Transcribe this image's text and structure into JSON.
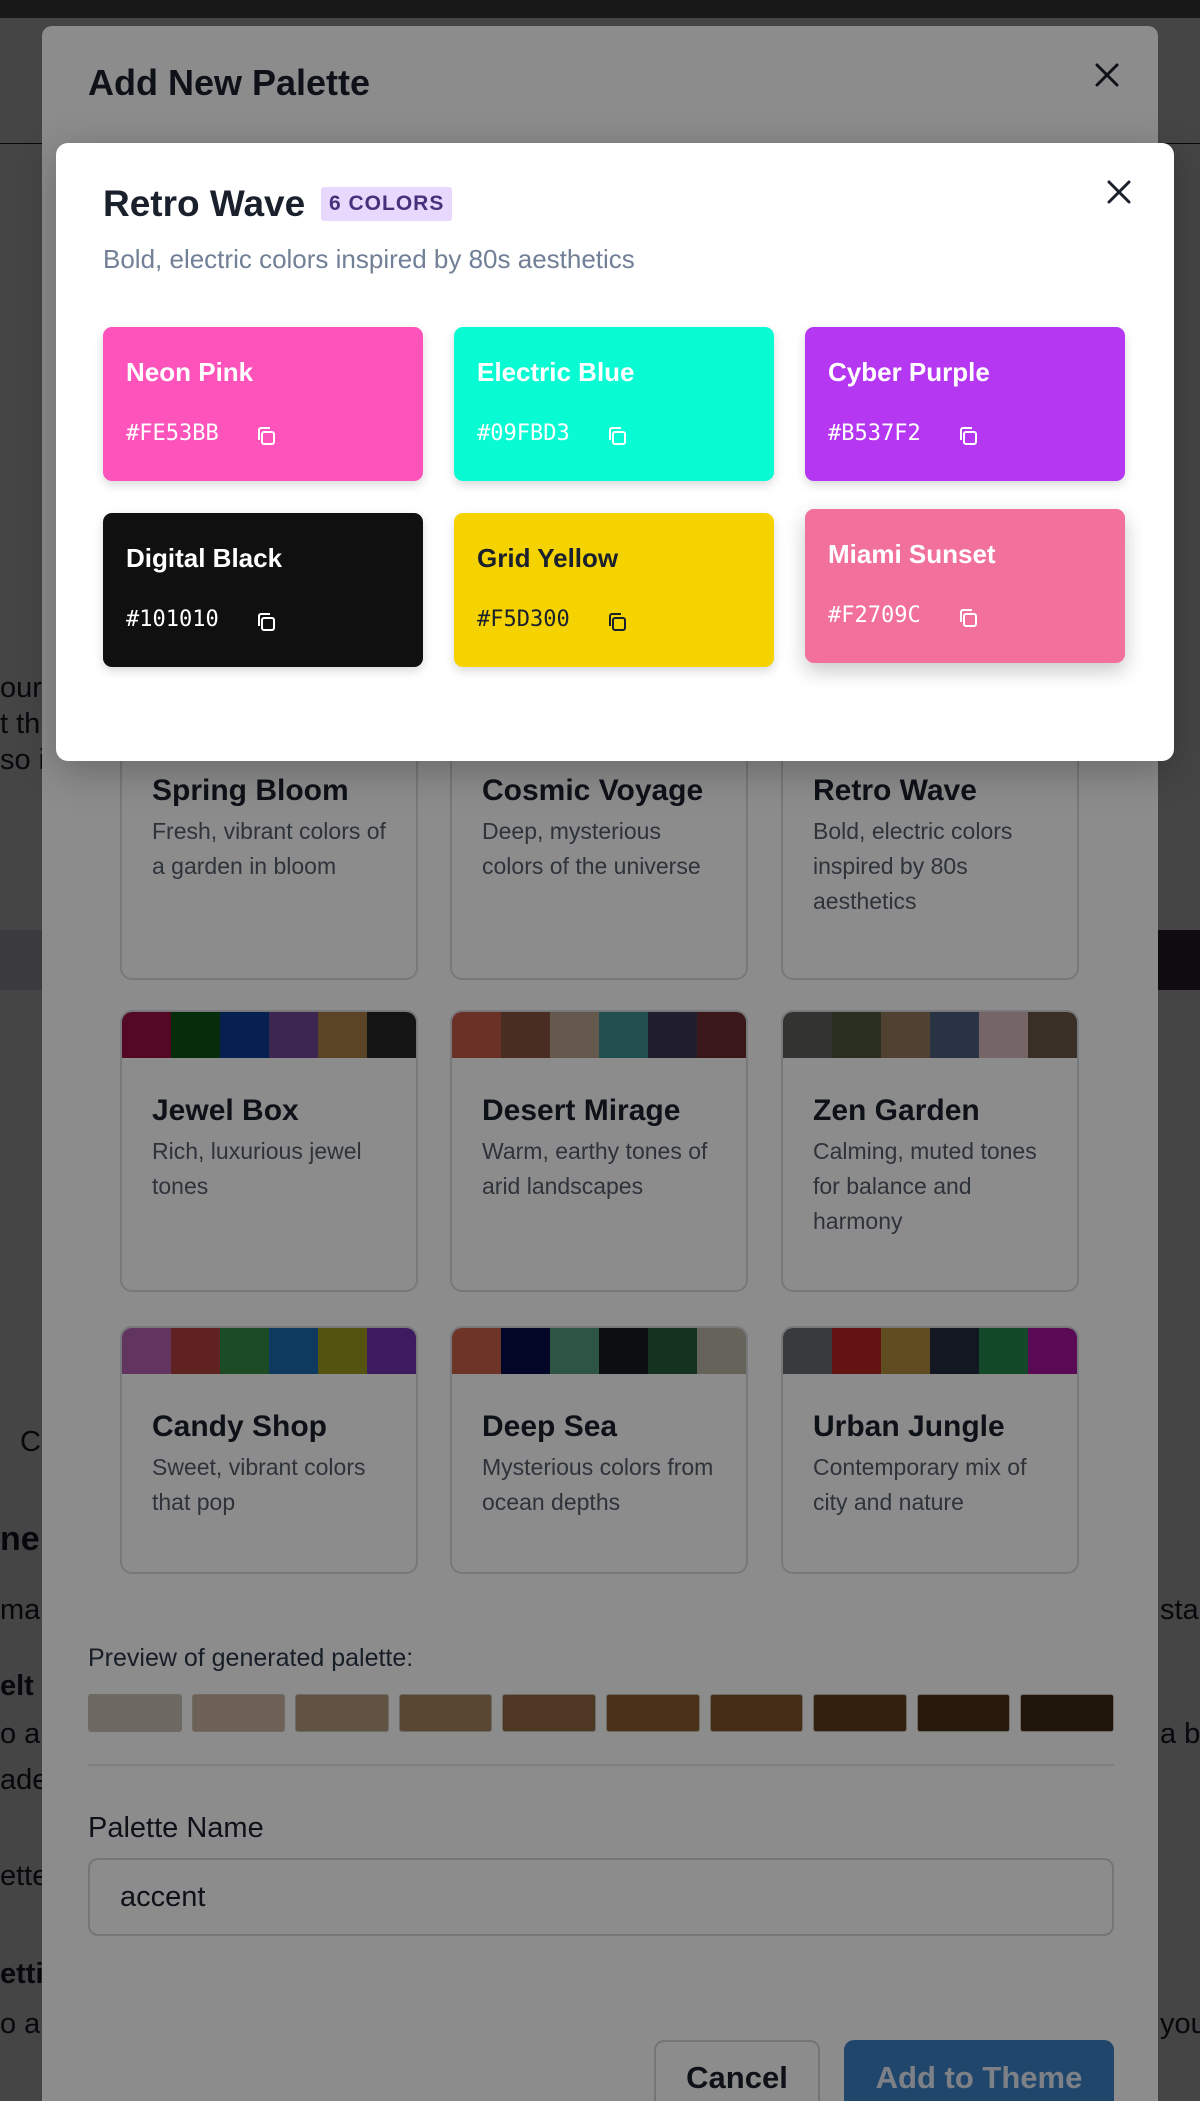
{
  "background": {
    "fragments": [
      "our",
      "t th",
      "so i",
      "C",
      "ne",
      "ma",
      "elt",
      "o ar",
      "ade",
      "ette",
      "etti",
      "o a",
      "sta",
      "a ba",
      "you"
    ]
  },
  "dialog": {
    "title": "Add New Palette",
    "presets": [
      {
        "name": "Spring Bloom",
        "description": "Fresh, vibrant colors of a garden in bloom",
        "colors": []
      },
      {
        "name": "Cosmic Voyage",
        "description": "Deep, mysterious colors of the universe",
        "colors": []
      },
      {
        "name": "Retro Wave",
        "description": "Bold, electric colors inspired by 80s aesthetics",
        "colors": []
      },
      {
        "name": "Jewel Box",
        "description": "Rich, luxurious jewel tones",
        "colors": [
          "#9b1042",
          "#0b5315",
          "#0c3b93",
          "#6f4796",
          "#a67d45",
          "#262626"
        ]
      },
      {
        "name": "Desert Mirage",
        "description": "Warm, earthy tones of arid landscapes",
        "colors": [
          "#c45a47",
          "#85533f",
          "#b9a38c",
          "#3f9190",
          "#3b3852",
          "#6b2a2c"
        ]
      },
      {
        "name": "Zen Garden",
        "description": "Calming, muted tones for balance and harmony",
        "colors": [
          "#5e5e5c",
          "#4f563f",
          "#93775a",
          "#4c5d7a",
          "#d7b8bb",
          "#6a5648"
        ]
      },
      {
        "name": "Candy Shop",
        "description": "Sweet, vibrant colors that pop",
        "colors": [
          "#b25fb0",
          "#b0403c",
          "#348a44",
          "#1c6aad",
          "#9a9a1e",
          "#7230b0"
        ]
      },
      {
        "name": "Deep Sea",
        "description": "Mysterious colors from ocean depths",
        "colors": [
          "#c85f48",
          "#090b49",
          "#559a7a",
          "#181b22",
          "#255c3a",
          "#bab7a5"
        ]
      },
      {
        "name": "Urban Jungle",
        "description": "Contemporary mix of city and nature",
        "colors": [
          "#666a6e",
          "#b42422",
          "#b08a3c",
          "#232a3c",
          "#23864a",
          "#a4129a"
        ]
      }
    ],
    "preview_label": "Preview of generated palette:",
    "preview_colors": [
      "#c7bfb3",
      "#c7b099",
      "#b3957c",
      "#a3805e",
      "#8f6642",
      "#8a5a2f",
      "#7c5029",
      "#5f3b1c",
      "#4b2f16",
      "#3b2712"
    ],
    "name_label": "Palette Name",
    "name_value": "accent",
    "cancel_label": "Cancel",
    "add_label": "Add to Theme"
  },
  "modal": {
    "title": "Retro Wave",
    "badge": "6 COLORS",
    "description": "Bold, electric colors inspired by 80s aesthetics",
    "colors": [
      {
        "name": "Neon Pink",
        "hex": "#FE53BB"
      },
      {
        "name": "Electric Blue",
        "hex": "#09FBD3"
      },
      {
        "name": "Cyber Purple",
        "hex": "#B537F2"
      },
      {
        "name": "Digital Black",
        "hex": "#101010"
      },
      {
        "name": "Grid Yellow",
        "hex": "#F5D300"
      },
      {
        "name": "Miami Sunset",
        "hex": "#F2709C"
      }
    ]
  }
}
